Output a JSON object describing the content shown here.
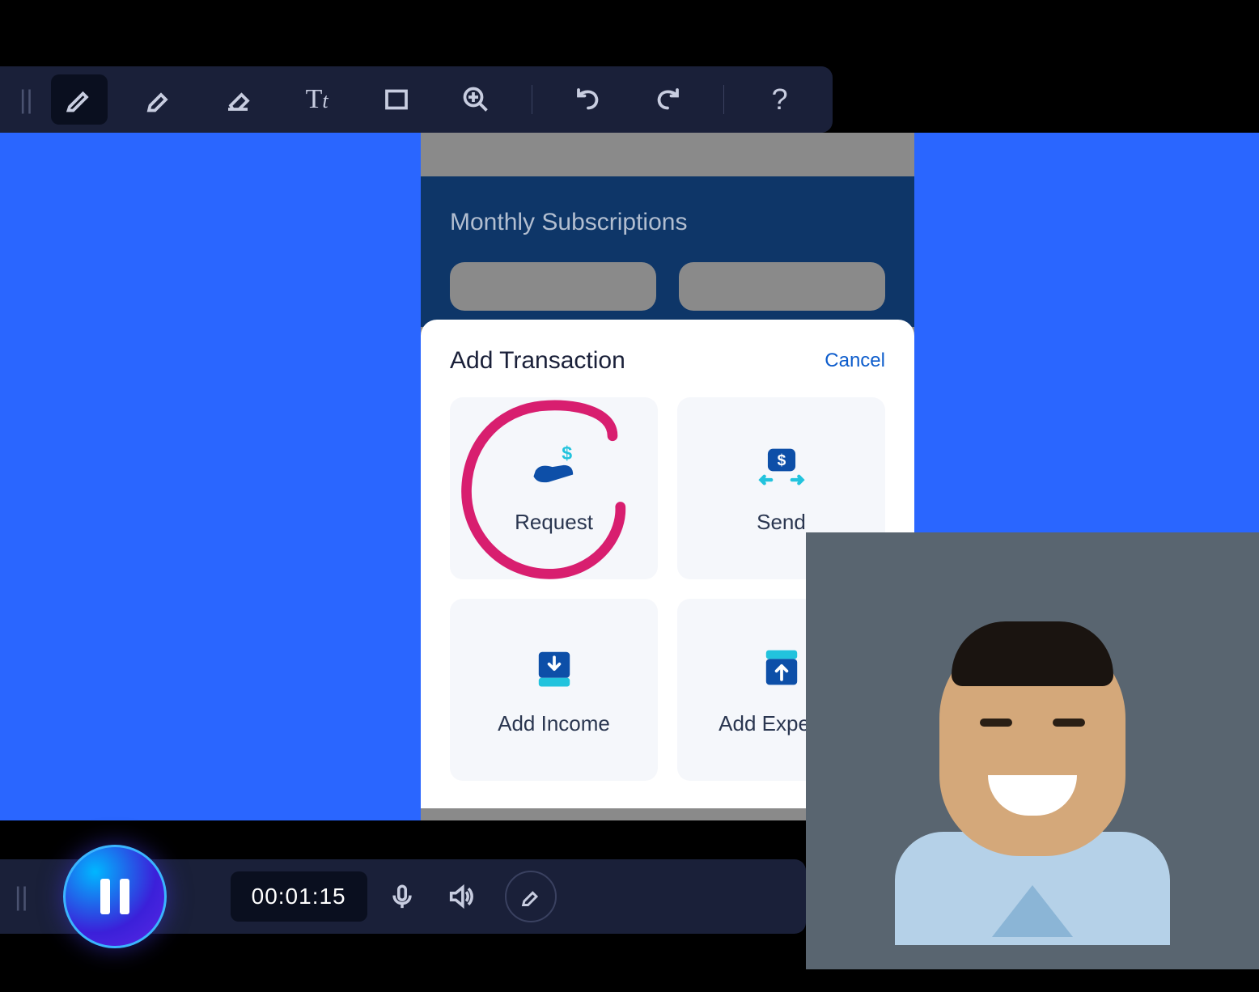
{
  "toolbar": {
    "icons": [
      "pen-icon",
      "highlighter-icon",
      "eraser-icon",
      "text-icon",
      "rectangle-icon",
      "zoom-icon",
      "undo-icon",
      "redo-icon",
      "help-icon"
    ]
  },
  "background_section": {
    "title": "Monthly Subscriptions"
  },
  "modal": {
    "title": "Add Transaction",
    "cancel": "Cancel",
    "options": [
      {
        "label": "Request"
      },
      {
        "label": "Send"
      },
      {
        "label": "Add Income"
      },
      {
        "label": "Add Expense"
      }
    ]
  },
  "annotation": {
    "color": "#d81e6f"
  },
  "recorder": {
    "time": "00:01:15"
  }
}
